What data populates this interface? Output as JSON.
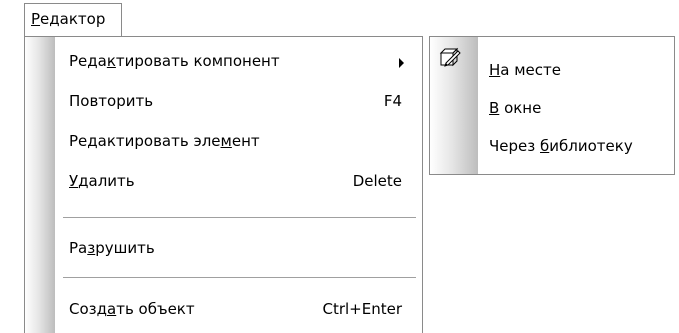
{
  "menubar": {
    "menu_title": {
      "text": "Редактор",
      "access_key": "Р"
    }
  },
  "menu": {
    "items": [
      {
        "label": "Редактировать компонент",
        "access_key": "к",
        "shortcut": "",
        "submenu_arrow": true
      },
      {
        "label": "Повторить",
        "access_key": "",
        "shortcut": "F4"
      },
      {
        "label": "Редактировать элемент",
        "access_key": "м",
        "shortcut": ""
      },
      {
        "label": "Удалить",
        "access_key": "У",
        "shortcut": "Delete"
      },
      {
        "label": "Разрушить",
        "access_key": "з",
        "shortcut": ""
      },
      {
        "label": "Создать объект",
        "access_key": "а",
        "shortcut": "Ctrl+Enter"
      }
    ]
  },
  "submenu": {
    "icon": "edit-in-place-icon",
    "items": [
      {
        "label": "На месте",
        "access_key": "Н"
      },
      {
        "label": "В окне",
        "access_key": "В"
      },
      {
        "label": "Через библиотеку",
        "access_key": "б"
      }
    ]
  },
  "colors": {
    "border": "#8a8a8a",
    "gutter_shadow": "#bdbdbd",
    "background": "#ffffff"
  }
}
